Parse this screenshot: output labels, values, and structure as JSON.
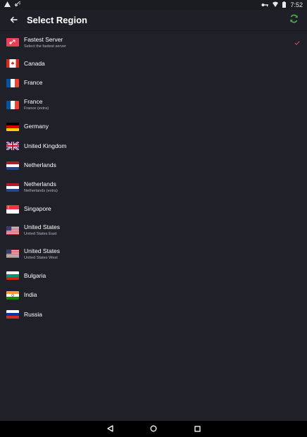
{
  "status_bar": {
    "time": "7:52",
    "left_icons": [
      "warning-icon",
      "link-icon"
    ],
    "right_icons": [
      "vpn-key-icon",
      "wifi-icon",
      "battery-icon"
    ]
  },
  "app_bar": {
    "title": "Select Region",
    "back_icon": "arrow-left-icon",
    "refresh_icon": "refresh-icon",
    "accent_color": "#4caf50"
  },
  "colors": {
    "background": "#202128",
    "checkmark": "#d04a56",
    "fastest_badge": "#e9405a"
  },
  "regions": [
    {
      "name": "Fastest Server",
      "sub": "Select the fastest server",
      "flag": "fastest",
      "selected": true
    },
    {
      "name": "Canada",
      "sub": "",
      "flag": "ca",
      "selected": false
    },
    {
      "name": "France",
      "sub": "",
      "flag": "fr",
      "selected": false
    },
    {
      "name": "France",
      "sub": "France (extra)",
      "flag": "fr",
      "selected": false
    },
    {
      "name": "Germany",
      "sub": "",
      "flag": "de",
      "selected": false
    },
    {
      "name": "United Kingdom",
      "sub": "",
      "flag": "gb",
      "selected": false
    },
    {
      "name": "Netherlands",
      "sub": "",
      "flag": "nl",
      "selected": false
    },
    {
      "name": "Netherlands",
      "sub": "Netherlands (extra)",
      "flag": "nl",
      "selected": false
    },
    {
      "name": "Singapore",
      "sub": "",
      "flag": "sg",
      "selected": false
    },
    {
      "name": "United States",
      "sub": "United States East",
      "flag": "us",
      "selected": false
    },
    {
      "name": "United States",
      "sub": "United States West",
      "flag": "us",
      "selected": false
    },
    {
      "name": "Bulgaria",
      "sub": "",
      "flag": "bg",
      "selected": false
    },
    {
      "name": "India",
      "sub": "",
      "flag": "in",
      "selected": false
    },
    {
      "name": "Russia",
      "sub": "",
      "flag": "ru",
      "selected": false
    }
  ],
  "nav_bar": {
    "buttons": [
      "back-triangle-icon",
      "home-circle-icon",
      "recents-square-icon"
    ]
  }
}
